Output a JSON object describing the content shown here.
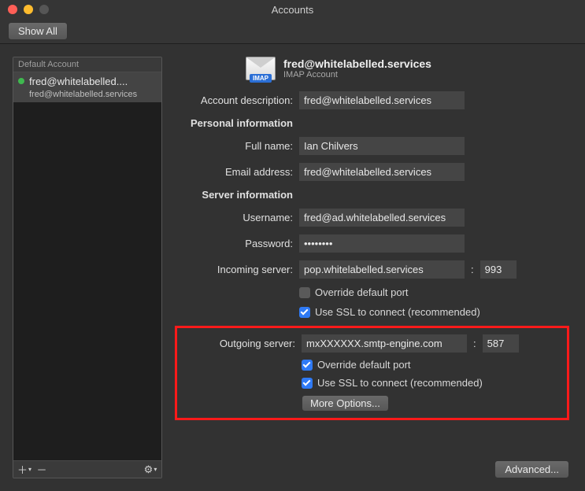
{
  "window": {
    "title": "Accounts"
  },
  "toolbar": {
    "show_all": "Show All"
  },
  "sidebar": {
    "header": "Default Account",
    "item_name": "fred@whitelabelled....",
    "item_sub": "fred@whitelabelled.services",
    "add_glyph": "＋",
    "add_dropdown_glyph": "▾",
    "remove_glyph": "－",
    "gear_glyph": "⚙",
    "gear_dropdown_glyph": "▾"
  },
  "header": {
    "title": "fred@whitelabelled.services",
    "subtitle": "IMAP Account",
    "badge": "IMAP"
  },
  "labels": {
    "description": "Account description:",
    "personal": "Personal information",
    "fullname": "Full name:",
    "email": "Email address:",
    "serverinfo": "Server information",
    "username": "Username:",
    "password": "Password:",
    "incoming": "Incoming server:",
    "outgoing": "Outgoing server:",
    "override": "Override default port",
    "usessl": "Use SSL to connect (recommended)",
    "moreopts": "More Options...",
    "advanced": "Advanced...",
    "port_sep": ":"
  },
  "values": {
    "description": "fred@whitelabelled.services",
    "fullname": "Ian Chilvers",
    "email": "fred@whitelabelled.services",
    "username": "fred@ad.whitelabelled.services",
    "password": "••••••••",
    "incoming_server": "pop.whitelabelled.services",
    "incoming_port": "993",
    "outgoing_server": "mxXXXXXX.smtp-engine.com",
    "outgoing_port": "587"
  }
}
